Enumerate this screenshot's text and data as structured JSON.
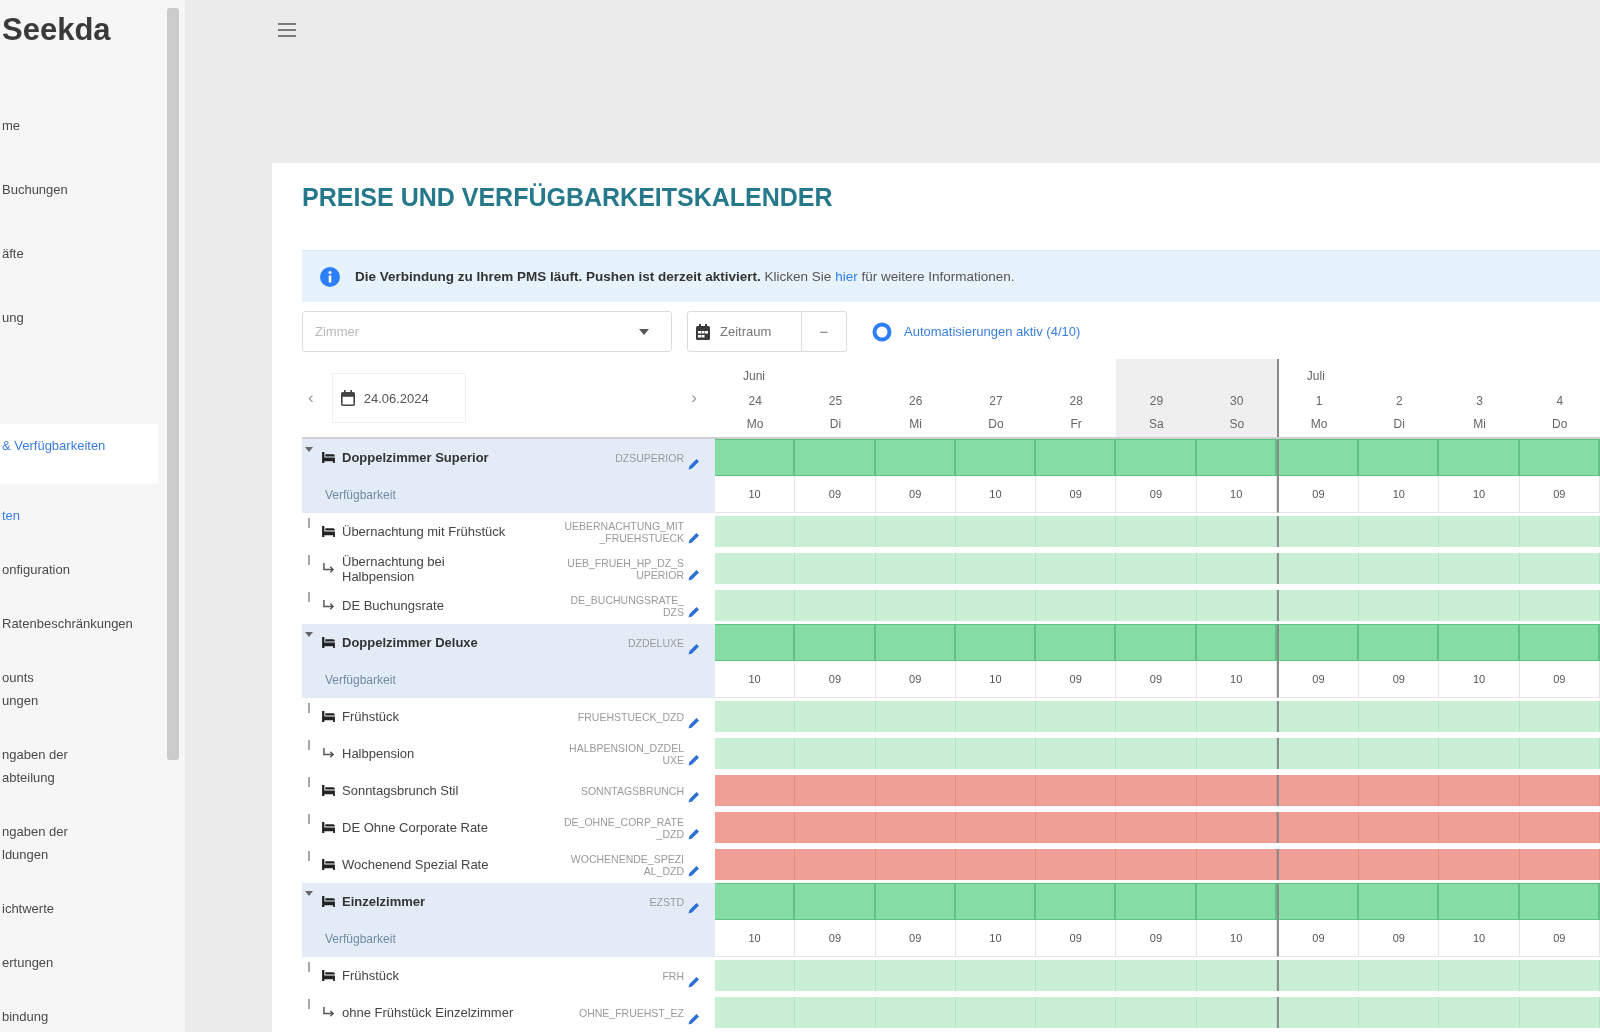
{
  "brand": {
    "name": "Seekda"
  },
  "sidebar": {
    "items": [
      {
        "label": "me",
        "selected": false
      },
      {
        "label": "Buchungen",
        "selected": false
      },
      {
        "label": "äfte",
        "selected": false
      },
      {
        "label": "ung",
        "selected": false
      }
    ],
    "group": {
      "label": "& Verfügbarkeiten",
      "expanded": true,
      "items": [
        {
          "label": "ten",
          "selected": true
        },
        {
          "label": "onfiguration",
          "selected": false
        },
        {
          "label": "Ratenbeschränkungen",
          "selected": false
        },
        {
          "label": "ounts\nungen",
          "selected": false
        },
        {
          "label": "ngaben der\nabteilung",
          "selected": false
        },
        {
          "label": "ngaben der\nldungen",
          "selected": false
        },
        {
          "label": "ichtwerte",
          "selected": false
        },
        {
          "label": "ertungen",
          "selected": false
        },
        {
          "label": "bindung",
          "selected": false
        }
      ]
    }
  },
  "calendar": {
    "title": "PREISE UND VERFÜGBARKEITSKALENDER",
    "notice": {
      "lead": "Die Verbindung zu Ihrem PMS läuft. Pushen ist derzeit aktiviert.",
      "before": "Klicken Sie",
      "link": "hier",
      "after": "für weitere Informationen."
    },
    "toolbar": {
      "room_select": {
        "placeholder": "Zimmer"
      },
      "period_button": {
        "label": "Zeitraum"
      },
      "more_button": {
        "label": "−"
      },
      "automation_link": {
        "label": "Automatisierungen aktiv (4/10)"
      }
    },
    "date_nav": {
      "prev": "‹",
      "date": "24.06.2024",
      "next": "›"
    },
    "dates": [
      {
        "month": "Juni",
        "day": "24",
        "weekday": "Mo",
        "weekend": false,
        "month_start": false
      },
      {
        "day": "25",
        "weekday": "Di",
        "weekend": false,
        "month_start": false
      },
      {
        "day": "26",
        "weekday": "Mi",
        "weekend": false,
        "month_start": false
      },
      {
        "day": "27",
        "weekday": "Do",
        "weekend": false,
        "month_start": false
      },
      {
        "day": "28",
        "weekday": "Fr",
        "weekend": false,
        "month_start": false
      },
      {
        "day": "29",
        "weekday": "Sa",
        "weekend": true,
        "month_start": false
      },
      {
        "day": "30",
        "weekday": "So",
        "weekend": true,
        "month_start": false
      },
      {
        "month": "Juli",
        "day": "1",
        "weekday": "Mo",
        "weekend": false,
        "month_start": true
      },
      {
        "day": "2",
        "weekday": "Di",
        "weekend": false,
        "month_start": false
      },
      {
        "day": "3",
        "weekday": "Mi",
        "weekend": false,
        "month_start": false
      },
      {
        "day": "4",
        "weekday": "Do",
        "weekend": false,
        "month_start": false
      }
    ],
    "rows": [
      {
        "kind": "room",
        "name": "Doppelzimmer Superior",
        "code": "DZSUPERIOR",
        "expanded": true
      },
      {
        "kind": "availability",
        "name": "Verfügbarkeit",
        "values": [
          "10",
          "09",
          "09",
          "10",
          "09",
          "09",
          "10",
          "09",
          "10",
          "10",
          "09"
        ]
      },
      {
        "kind": "rate",
        "name": "Übernachtung mit Frühstück",
        "code": "UEBERNACHTUNG_MIT_FRUEHSTUECK",
        "derived": false,
        "closed": false
      },
      {
        "kind": "rate",
        "name": "Übernachtung bei\nHalbpension",
        "code": "UEB_FRUEH_HP_DZ_SUPERIOR",
        "derived": true,
        "closed": false
      },
      {
        "kind": "rate",
        "name": "DE Buchungsrate",
        "code": "DE_BUCHUNGSRATE_DZS",
        "derived": true,
        "closed": false
      },
      {
        "kind": "room",
        "name": "Doppelzimmer Deluxe",
        "code": "DZDELUXE",
        "expanded": true
      },
      {
        "kind": "availability",
        "name": "Verfügbarkeit",
        "values": [
          "10",
          "09",
          "09",
          "10",
          "09",
          "09",
          "10",
          "09",
          "09",
          "10",
          "09"
        ]
      },
      {
        "kind": "rate",
        "name": "Frühstück",
        "code": "FRUEHSTUECK_DZD",
        "derived": false,
        "closed": false
      },
      {
        "kind": "rate",
        "name": "Halbpension",
        "code": "HALBPENSION_DZDELUXE",
        "derived": true,
        "closed": false
      },
      {
        "kind": "rate",
        "name": "Sonntagsbrunch Stil",
        "code": "SONNTAGSBRUNCH",
        "derived": false,
        "closed": true
      },
      {
        "kind": "rate",
        "name": "DE Ohne Corporate Rate",
        "code": "DE_OHNE_CORP_RATE_DZD",
        "derived": false,
        "closed": true
      },
      {
        "kind": "rate",
        "name": "Wochenend Spezial Rate",
        "code": "WOCHENENDE_SPEZIAL_DZD",
        "derived": false,
        "closed": true
      },
      {
        "kind": "room",
        "name": "Einzelzimmer",
        "code": "EZSTD",
        "expanded": true
      },
      {
        "kind": "availability",
        "name": "Verfügbarkeit",
        "values": [
          "10",
          "09",
          "09",
          "10",
          "09",
          "09",
          "10",
          "09",
          "09",
          "10",
          "09"
        ]
      },
      {
        "kind": "rate",
        "name": "Frühstück",
        "code": "FRH",
        "derived": false,
        "closed": false
      },
      {
        "kind": "rate",
        "name": "ohne Frühstück Einzelzimmer",
        "code": "OHNE_FRUEHST_EZ",
        "derived": true,
        "closed": false
      }
    ]
  }
}
